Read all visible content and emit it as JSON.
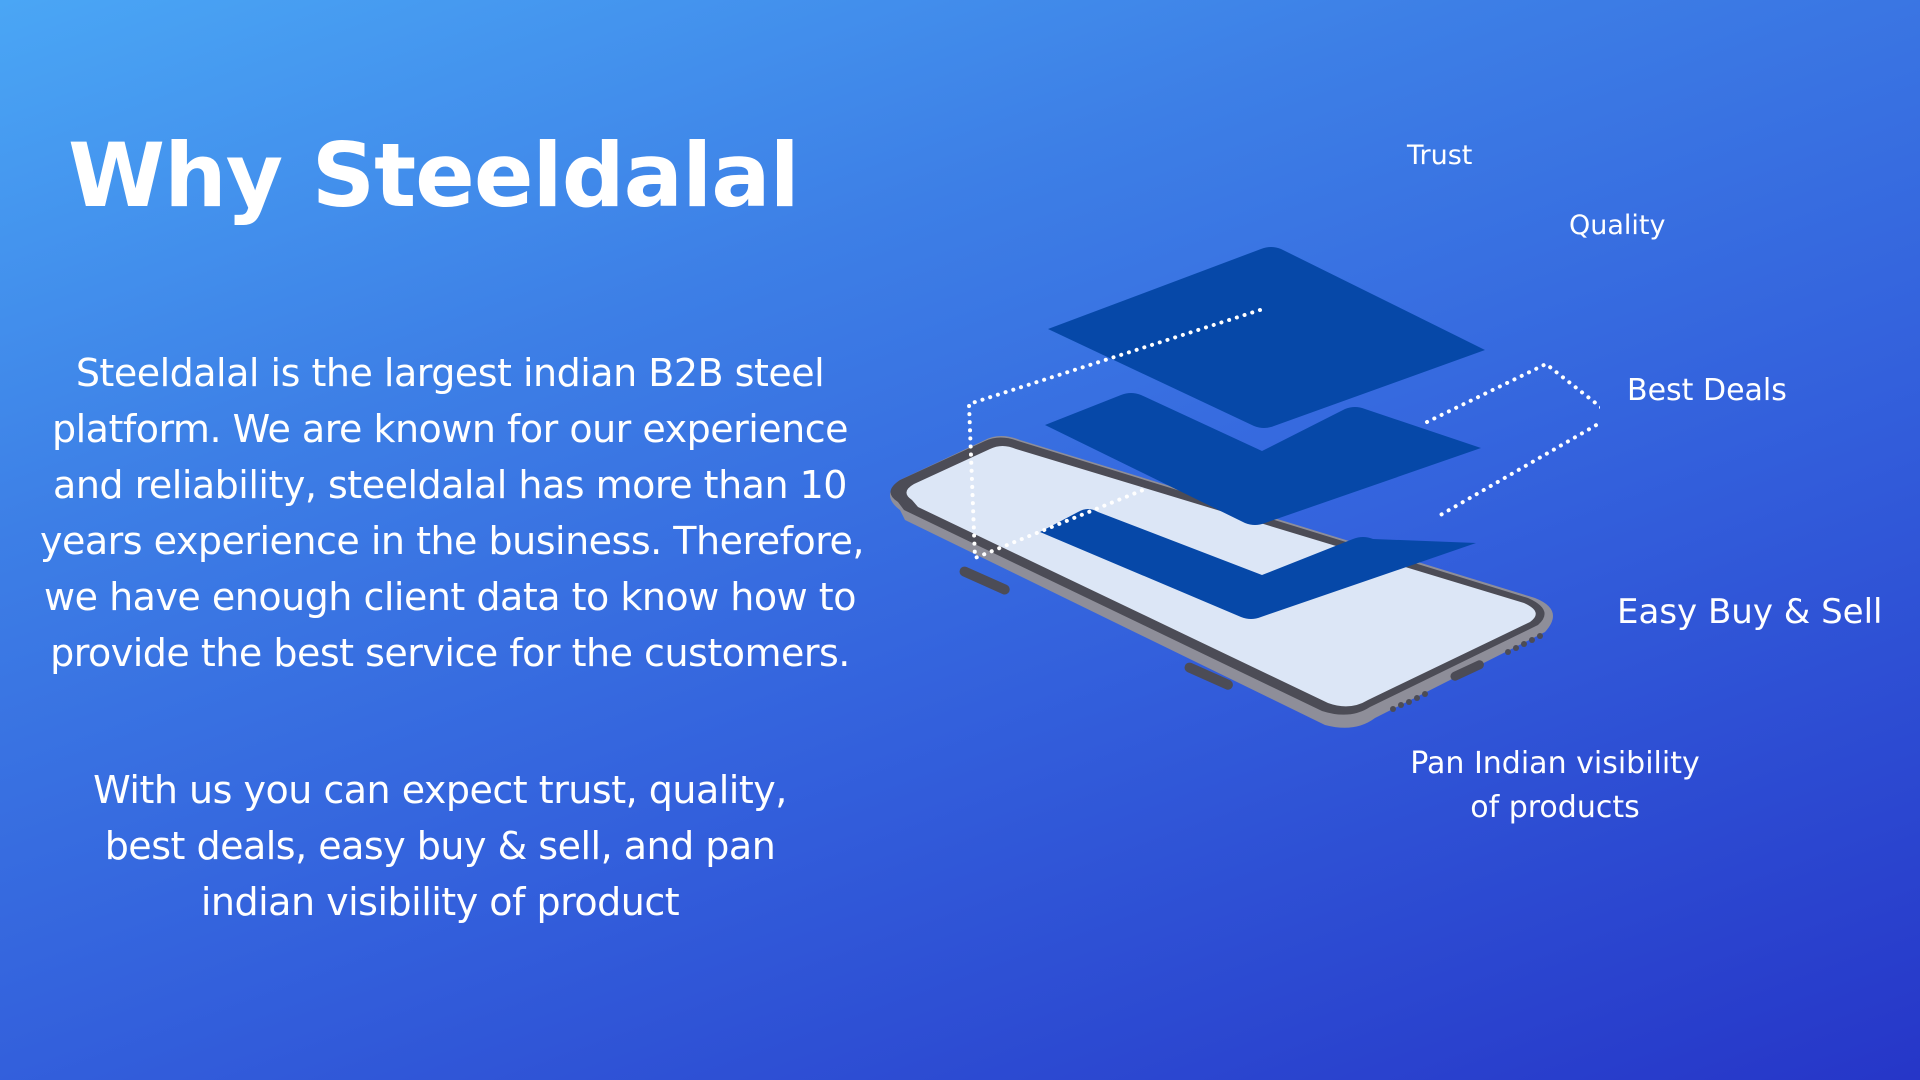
{
  "slide": {
    "title": "Why Steeldalal",
    "description_lines": [
      "Steeldalal is the largest indian B2B steel",
      "platform. We are known for our experience",
      "and reliability, steeldalal has more than 10",
      "years experience in the business. Therefore,",
      "we have enough client data to know how to",
      "provide the best service for the customers."
    ],
    "expectation_lines": [
      "With us you can expect trust, quality,",
      "best deals, easy buy & sell, and pan",
      "indian visibility of product"
    ]
  },
  "features": {
    "trust": "Trust",
    "quality": "Quality",
    "best_deals": "Best Deals",
    "easy_buy_sell": "Easy Buy & Sell",
    "pan_indian": [
      "Pan Indian visibility",
      "of products"
    ]
  },
  "illustration": {
    "icon": "isometric-phone-layers-illustration",
    "colors": {
      "layer": "#0648a8",
      "screen": "#dce6f6",
      "phone_frame": "#8e8e99",
      "phone_bezel": "#4c4c56",
      "dotted_line": "#ffffff"
    }
  }
}
